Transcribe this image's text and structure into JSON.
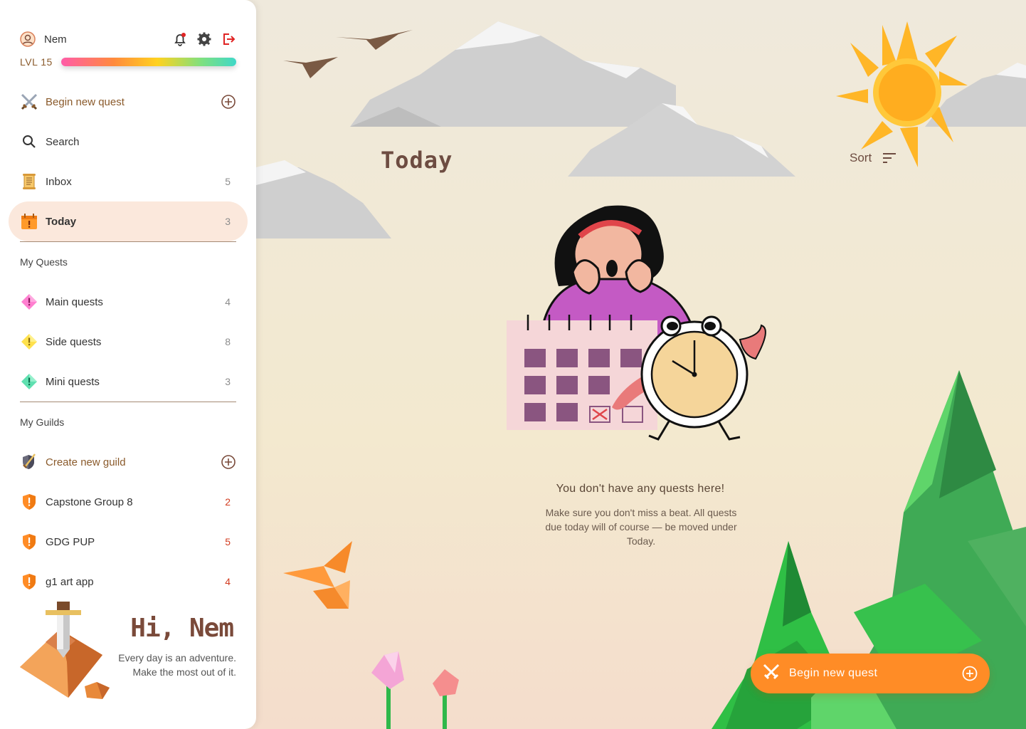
{
  "user": {
    "name": "Nem",
    "level_label": "LVL 15"
  },
  "nav": {
    "begin_quest": "Begin new quest",
    "search": "Search",
    "inbox": {
      "label": "Inbox",
      "count": "5"
    },
    "today": {
      "label": "Today",
      "count": "3"
    }
  },
  "my_quests": {
    "title": "My Quests",
    "items": [
      {
        "label": "Main quests",
        "count": "4",
        "color": "#ff7fd0"
      },
      {
        "label": "Side quests",
        "count": "8",
        "color": "#ffe14d"
      },
      {
        "label": "Mini quests",
        "count": "3",
        "color": "#5fe0b0"
      }
    ]
  },
  "my_guilds": {
    "title": "My Guilds",
    "create": "Create new guild",
    "items": [
      {
        "label": "Capstone Group 8",
        "count": "2"
      },
      {
        "label": "GDG PUP",
        "count": "5"
      },
      {
        "label": "g1 art app",
        "count": "4"
      }
    ]
  },
  "greeting": {
    "title": "Hi, Nem",
    "subtitle": "Every day is an adventure. Make the most out of it."
  },
  "main": {
    "title": "Today",
    "sort_label": "Sort",
    "empty_title": "You don't have any quests here!",
    "empty_desc": "Make sure you don't miss a beat. All quests due today will of course — be moved under Today."
  },
  "fab": {
    "label": "Begin new quest"
  },
  "colors": {
    "accent": "#ff8c26",
    "brown": "#8a5a2b",
    "active_bg": "#fbe8dc",
    "badge_red": "#d23b1f"
  }
}
